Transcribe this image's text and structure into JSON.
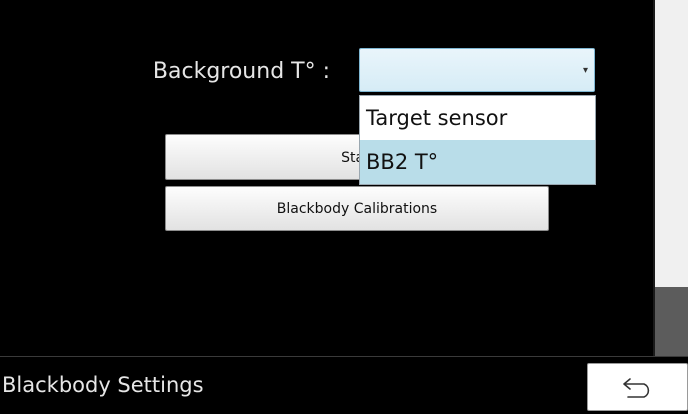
{
  "settings": {
    "background_label": "Background T° :",
    "select": {
      "selected_value": "",
      "arrow": "▾"
    },
    "dropdown_options": [
      "Target sensor",
      "BB2 T°"
    ],
    "highlighted_option": "BB2 T°",
    "buttons": {
      "stabilization_label": "Stab",
      "blackbody_calibrations_label": "Blackbody Calibrations"
    }
  },
  "footer": {
    "title": "Blackbody Settings",
    "back_icon": "back-arrow-icon"
  },
  "colors": {
    "background": "#000000",
    "select_border": "#7fb7d3",
    "highlight": "#b9dde9",
    "scroll_thumb": "#5c5c5c"
  }
}
